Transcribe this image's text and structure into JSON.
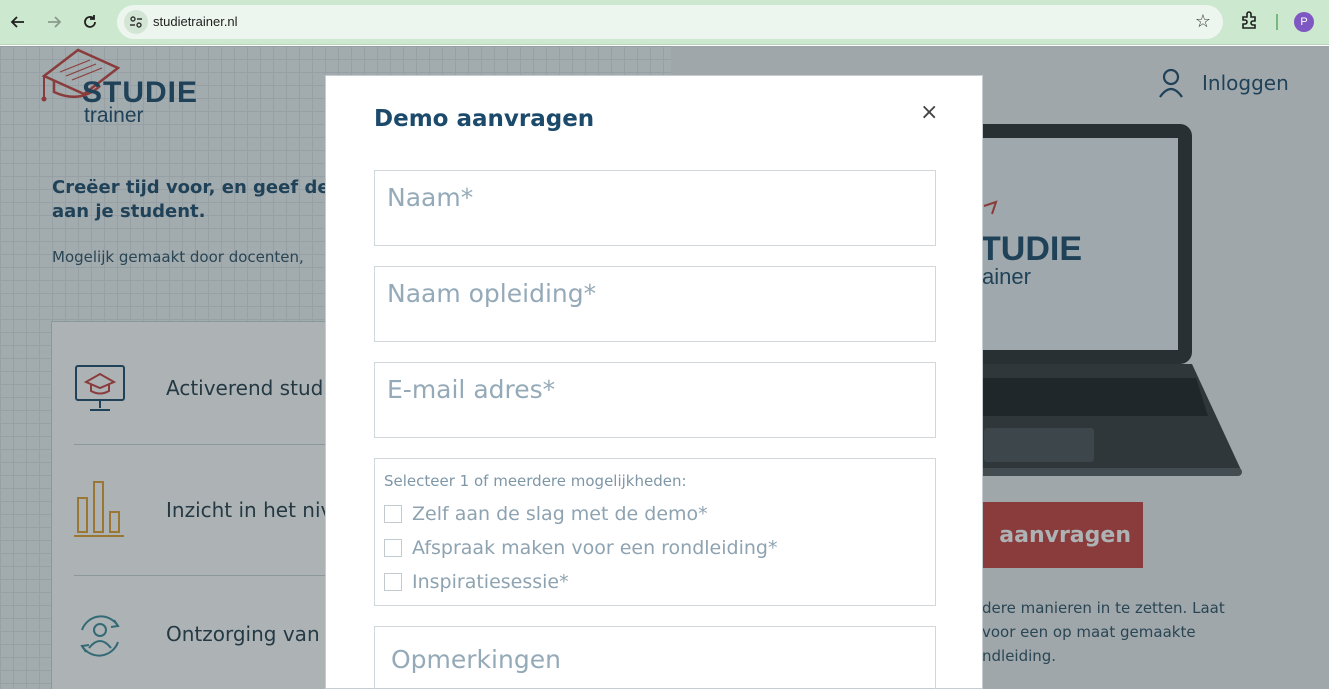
{
  "browser": {
    "url": "studietrainer.nl",
    "profile_initial": "P"
  },
  "site": {
    "logo_line1": "STUDIE",
    "logo_line2": "trainer",
    "login_label": "Inloggen",
    "hero_title": "Creëer tijd voor, en geef de aan je student.",
    "hero_title_line1": "Creëer tijd voor, en geef de",
    "hero_title_line2": "aan je student.",
    "hero_sub": "Mogelijk gemaakt door docenten,",
    "features": [
      {
        "label": "Activerend studi",
        "icon": "monitor-graduation-cap-icon"
      },
      {
        "label": "Inzicht in het nive",
        "icon": "bar-chart-icon"
      },
      {
        "label": "Ontzorging van d",
        "icon": "user-refresh-icon"
      }
    ],
    "cta_label": "aanvragen",
    "right_text_line1": "dere manieren in te zetten. Laat",
    "right_text_line2": "voor een op maat gemaakte",
    "right_text_line3": "ndleiding.",
    "laptop_logo_line1": "TUDIE",
    "laptop_logo_line2": "ainer"
  },
  "modal": {
    "title": "Demo aanvragen",
    "close_label": "×",
    "fields": {
      "name_placeholder": "Naam*",
      "program_placeholder": "Naam opleiding*",
      "email_placeholder": "E-mail adres*"
    },
    "choices_label": "Selecteer 1 of meerdere mogelijkheden:",
    "choices": [
      {
        "label": "Zelf aan de slag met de demo*",
        "checked": false
      },
      {
        "label": "Afspraak maken voor een rondleiding*",
        "checked": false
      },
      {
        "label": "Inspiratiesessie*",
        "checked": false
      }
    ],
    "remarks_placeholder": "Opmerkingen"
  },
  "colors": {
    "brand_blue": "#1c4a6b",
    "brand_red": "#c7403d",
    "chrome_green": "#cce8cf"
  }
}
